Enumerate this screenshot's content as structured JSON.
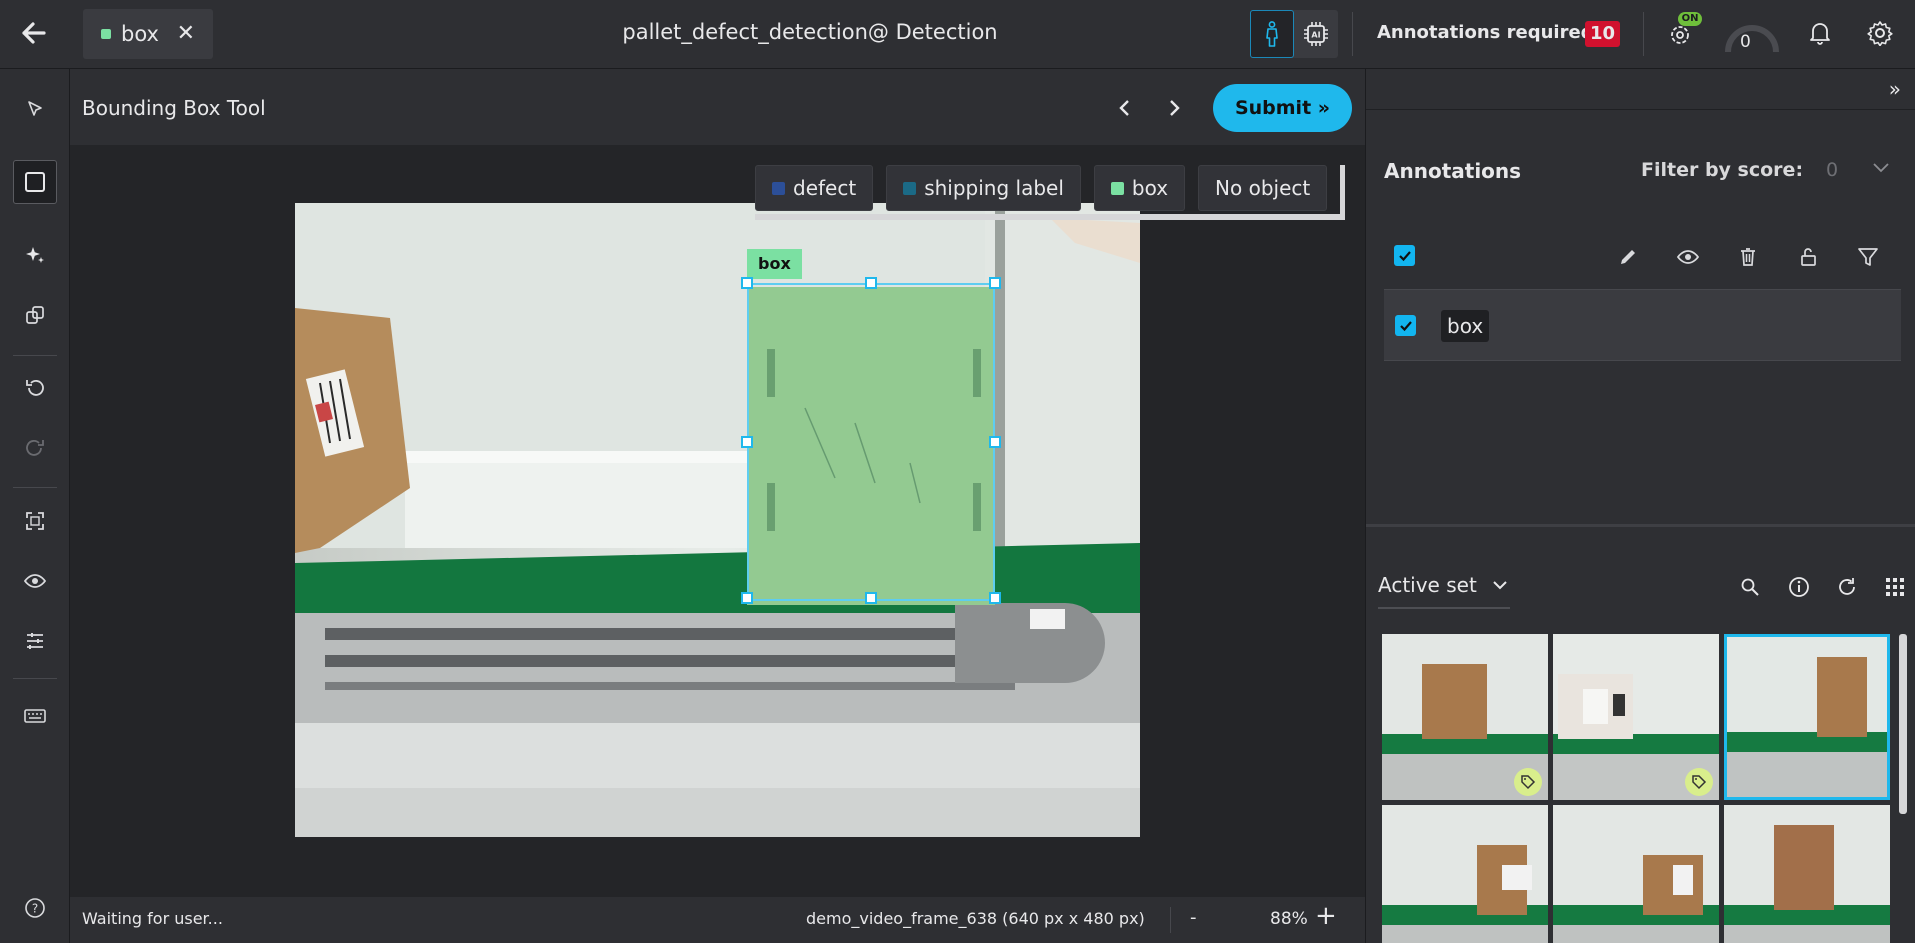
{
  "header": {
    "back_icon": "arrow-left-icon",
    "tab": {
      "label": "box",
      "dot_color": "#7be0a2"
    },
    "title": "pallet_defect_detection@ Detection",
    "annotations_required_label": "Annotations required:",
    "annotations_required_count": "10",
    "auto_training_badge": "ON",
    "credits": "0"
  },
  "tools": [
    "selector-tool",
    "bounding-box-tool",
    "smart-tool",
    "copy-tool",
    "undo",
    "redo",
    "fit-image",
    "visibility",
    "adjustments",
    "hotkeys",
    "help"
  ],
  "toolbar": {
    "tool_name": "Bounding Box Tool",
    "submit_label": "Submit »"
  },
  "labels": [
    {
      "name": "defect",
      "color": "#2c4f98"
    },
    {
      "name": "shipping label",
      "color": "#1b6a86"
    },
    {
      "name": "box",
      "color": "#7be0a2"
    },
    {
      "name": "No object",
      "color": ""
    }
  ],
  "canvas": {
    "shape_label": "box"
  },
  "statusbar": {
    "status": "Waiting for user...",
    "media_info": "demo_video_frame_638 (640 px x 480 px)",
    "zoom_out": "-",
    "zoom": "88%",
    "zoom_in": "+"
  },
  "panel": {
    "collapse": "»",
    "annotations_title": "Annotations",
    "filter_label": "Filter by score:",
    "filter_value": "0",
    "annotation_items": [
      {
        "label": "box",
        "checked": true
      }
    ],
    "active_set_label": "Active set"
  }
}
